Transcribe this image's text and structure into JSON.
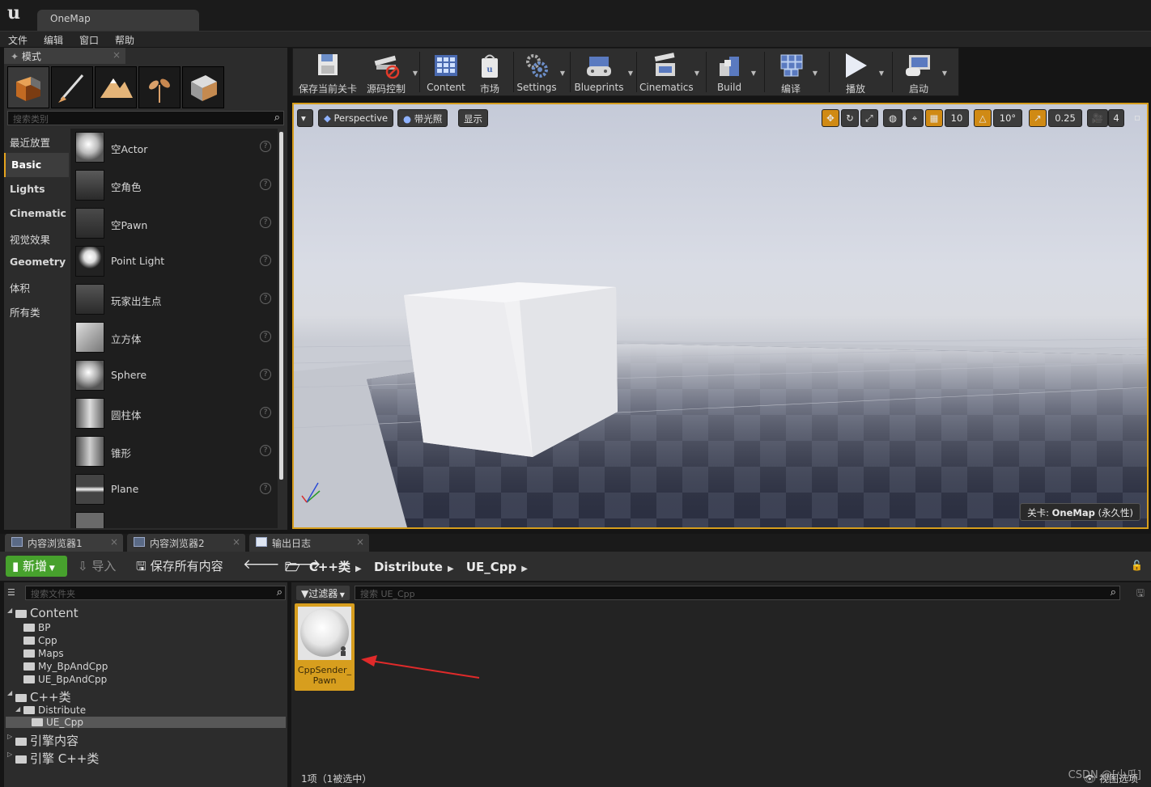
{
  "window": {
    "tab_title": "OneMap"
  },
  "menu": [
    "文件",
    "编辑",
    "窗口",
    "帮助"
  ],
  "modes_panel": {
    "tab_label": "模式",
    "search_placeholder": "搜索类别",
    "categories": [
      "最近放置",
      "Basic",
      "Lights",
      "Cinematic",
      "视觉效果",
      "Geometry",
      "体积",
      "所有类"
    ],
    "items": [
      "空Actor",
      "空角色",
      "空Pawn",
      "Point Light",
      "玩家出生点",
      "立方体",
      "Sphere",
      "圆柱体",
      "锥形",
      "Plane"
    ]
  },
  "toolbar": {
    "buttons": [
      "保存当前关卡",
      "源码控制",
      "Content",
      "市场",
      "Settings",
      "Blueprints",
      "Cinematics",
      "Build",
      "编译",
      "播放",
      "启动"
    ]
  },
  "viewport": {
    "perspective_label": "Perspective",
    "lit_label": "带光照",
    "show_label": "显示",
    "grid_snap": "10",
    "rotation_snap": "10°",
    "scale_snap": "0.25",
    "camera_speed": "4",
    "level_prefix": "关卡:",
    "level_name": "OneMap",
    "level_suffix": "(永久性)"
  },
  "bottom_tabs": [
    "内容浏览器1",
    "内容浏览器2",
    "输出日志"
  ],
  "content_browser": {
    "add_new": "新增",
    "import": "导入",
    "save_all": "保存所有内容",
    "breadcrumb": [
      "C++类",
      "Distribute",
      "UE_Cpp"
    ],
    "folder_search_placeholder": "搜索文件夹",
    "filter_label": "过滤器",
    "asset_search_placeholder": "搜索 UE_Cpp",
    "tree": {
      "content": "Content",
      "content_children": [
        "BP",
        "Cpp",
        "Maps",
        "My_BpAndCpp",
        "UE_BpAndCpp"
      ],
      "cpp_classes": "C++类",
      "distribute": "Distribute",
      "ue_cpp": "UE_Cpp",
      "engine_content": "引擎内容",
      "engine_cpp": "引擎 C++类"
    },
    "asset": {
      "name_line1": "CppSender_",
      "name_line2": "Pawn"
    },
    "item_count": "1项（1被选中）",
    "view_options": "视图选项",
    "watermark": "CSDN @[小瓜]"
  },
  "colors": {
    "accent": "#d69d1c",
    "add_new_green": "#47a12d",
    "arrow_red": "#e02a2a"
  }
}
